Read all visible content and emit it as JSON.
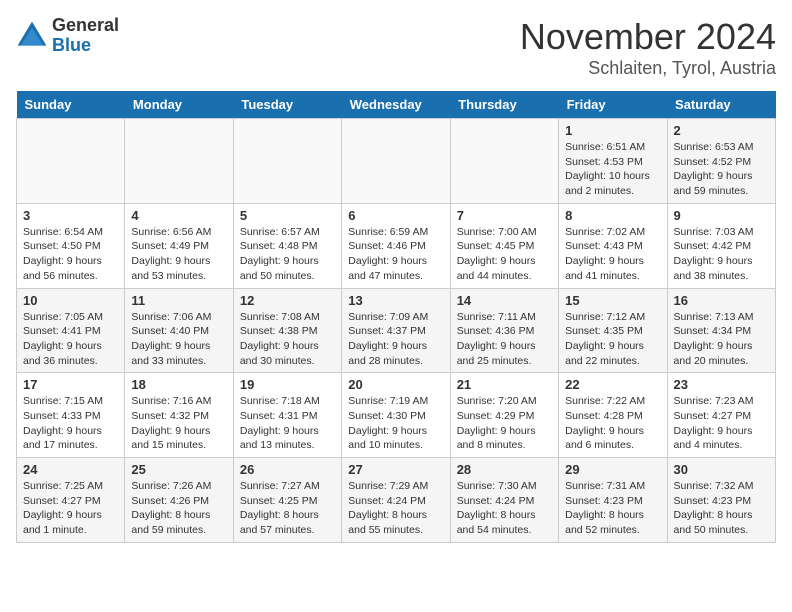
{
  "header": {
    "logo_general": "General",
    "logo_blue": "Blue",
    "month_title": "November 2024",
    "location": "Schlaiten, Tyrol, Austria"
  },
  "days_of_week": [
    "Sunday",
    "Monday",
    "Tuesday",
    "Wednesday",
    "Thursday",
    "Friday",
    "Saturday"
  ],
  "weeks": [
    [
      {
        "day": "",
        "info": ""
      },
      {
        "day": "",
        "info": ""
      },
      {
        "day": "",
        "info": ""
      },
      {
        "day": "",
        "info": ""
      },
      {
        "day": "",
        "info": ""
      },
      {
        "day": "1",
        "info": "Sunrise: 6:51 AM\nSunset: 4:53 PM\nDaylight: 10 hours\nand 2 minutes."
      },
      {
        "day": "2",
        "info": "Sunrise: 6:53 AM\nSunset: 4:52 PM\nDaylight: 9 hours\nand 59 minutes."
      }
    ],
    [
      {
        "day": "3",
        "info": "Sunrise: 6:54 AM\nSunset: 4:50 PM\nDaylight: 9 hours\nand 56 minutes."
      },
      {
        "day": "4",
        "info": "Sunrise: 6:56 AM\nSunset: 4:49 PM\nDaylight: 9 hours\nand 53 minutes."
      },
      {
        "day": "5",
        "info": "Sunrise: 6:57 AM\nSunset: 4:48 PM\nDaylight: 9 hours\nand 50 minutes."
      },
      {
        "day": "6",
        "info": "Sunrise: 6:59 AM\nSunset: 4:46 PM\nDaylight: 9 hours\nand 47 minutes."
      },
      {
        "day": "7",
        "info": "Sunrise: 7:00 AM\nSunset: 4:45 PM\nDaylight: 9 hours\nand 44 minutes."
      },
      {
        "day": "8",
        "info": "Sunrise: 7:02 AM\nSunset: 4:43 PM\nDaylight: 9 hours\nand 41 minutes."
      },
      {
        "day": "9",
        "info": "Sunrise: 7:03 AM\nSunset: 4:42 PM\nDaylight: 9 hours\nand 38 minutes."
      }
    ],
    [
      {
        "day": "10",
        "info": "Sunrise: 7:05 AM\nSunset: 4:41 PM\nDaylight: 9 hours\nand 36 minutes."
      },
      {
        "day": "11",
        "info": "Sunrise: 7:06 AM\nSunset: 4:40 PM\nDaylight: 9 hours\nand 33 minutes."
      },
      {
        "day": "12",
        "info": "Sunrise: 7:08 AM\nSunset: 4:38 PM\nDaylight: 9 hours\nand 30 minutes."
      },
      {
        "day": "13",
        "info": "Sunrise: 7:09 AM\nSunset: 4:37 PM\nDaylight: 9 hours\nand 28 minutes."
      },
      {
        "day": "14",
        "info": "Sunrise: 7:11 AM\nSunset: 4:36 PM\nDaylight: 9 hours\nand 25 minutes."
      },
      {
        "day": "15",
        "info": "Sunrise: 7:12 AM\nSunset: 4:35 PM\nDaylight: 9 hours\nand 22 minutes."
      },
      {
        "day": "16",
        "info": "Sunrise: 7:13 AM\nSunset: 4:34 PM\nDaylight: 9 hours\nand 20 minutes."
      }
    ],
    [
      {
        "day": "17",
        "info": "Sunrise: 7:15 AM\nSunset: 4:33 PM\nDaylight: 9 hours\nand 17 minutes."
      },
      {
        "day": "18",
        "info": "Sunrise: 7:16 AM\nSunset: 4:32 PM\nDaylight: 9 hours\nand 15 minutes."
      },
      {
        "day": "19",
        "info": "Sunrise: 7:18 AM\nSunset: 4:31 PM\nDaylight: 9 hours\nand 13 minutes."
      },
      {
        "day": "20",
        "info": "Sunrise: 7:19 AM\nSunset: 4:30 PM\nDaylight: 9 hours\nand 10 minutes."
      },
      {
        "day": "21",
        "info": "Sunrise: 7:20 AM\nSunset: 4:29 PM\nDaylight: 9 hours\nand 8 minutes."
      },
      {
        "day": "22",
        "info": "Sunrise: 7:22 AM\nSunset: 4:28 PM\nDaylight: 9 hours\nand 6 minutes."
      },
      {
        "day": "23",
        "info": "Sunrise: 7:23 AM\nSunset: 4:27 PM\nDaylight: 9 hours\nand 4 minutes."
      }
    ],
    [
      {
        "day": "24",
        "info": "Sunrise: 7:25 AM\nSunset: 4:27 PM\nDaylight: 9 hours\nand 1 minute."
      },
      {
        "day": "25",
        "info": "Sunrise: 7:26 AM\nSunset: 4:26 PM\nDaylight: 8 hours\nand 59 minutes."
      },
      {
        "day": "26",
        "info": "Sunrise: 7:27 AM\nSunset: 4:25 PM\nDaylight: 8 hours\nand 57 minutes."
      },
      {
        "day": "27",
        "info": "Sunrise: 7:29 AM\nSunset: 4:24 PM\nDaylight: 8 hours\nand 55 minutes."
      },
      {
        "day": "28",
        "info": "Sunrise: 7:30 AM\nSunset: 4:24 PM\nDaylight: 8 hours\nand 54 minutes."
      },
      {
        "day": "29",
        "info": "Sunrise: 7:31 AM\nSunset: 4:23 PM\nDaylight: 8 hours\nand 52 minutes."
      },
      {
        "day": "30",
        "info": "Sunrise: 7:32 AM\nSunset: 4:23 PM\nDaylight: 8 hours\nand 50 minutes."
      }
    ]
  ]
}
